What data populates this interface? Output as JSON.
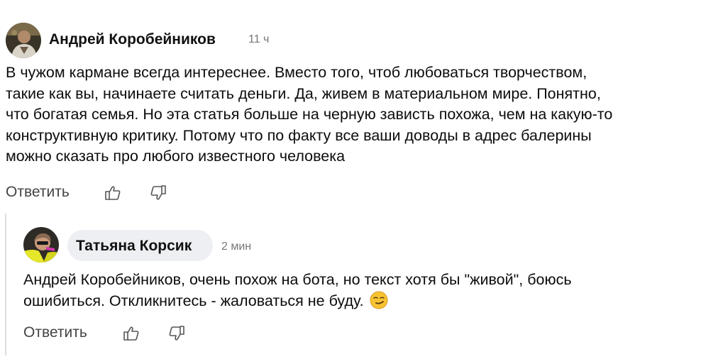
{
  "comments": [
    {
      "author": "Андрей Коробейников",
      "time": "11 ч",
      "lines": [
        "В чужом кармане всегда интереснее. Вместо того, чтоб любоваться творчеством,",
        "такие как вы, начинаете считать деньги. Да, живем в материальном мире. Понятно,",
        "что богатая семья. Но эта статья больше на черную зависть похожа, чем на какую-то",
        "конструктивную критику. Потому что по факту все ваши доводы в адрес балерины",
        "можно сказать про любого известного человека"
      ],
      "reply_label": "Ответить",
      "avatar_icon": "user-photo-avatar",
      "like_icon": "thumbs-up-icon",
      "dislike_icon": "thumbs-down-icon"
    },
    {
      "author": "Татьяна Корсик",
      "time": "2 мин",
      "lines": [
        "Андрей Коробейников, очень похож на бота, но текст хотя бы \"живой\", боюсь",
        "ошибиться. Откликнитесь - жаловаться не буду."
      ],
      "emoji": "smirk-emoji",
      "reply_label": "Ответить",
      "avatar_icon": "user-photo-avatar",
      "like_icon": "thumbs-up-icon",
      "dislike_icon": "thumbs-down-icon"
    }
  ],
  "colors": {
    "author": "#111111",
    "time": "#777777",
    "text": "#0c0c0c",
    "action": "#444444",
    "chip_bg": "#eeeff2",
    "thread_line": "#dddddd"
  }
}
